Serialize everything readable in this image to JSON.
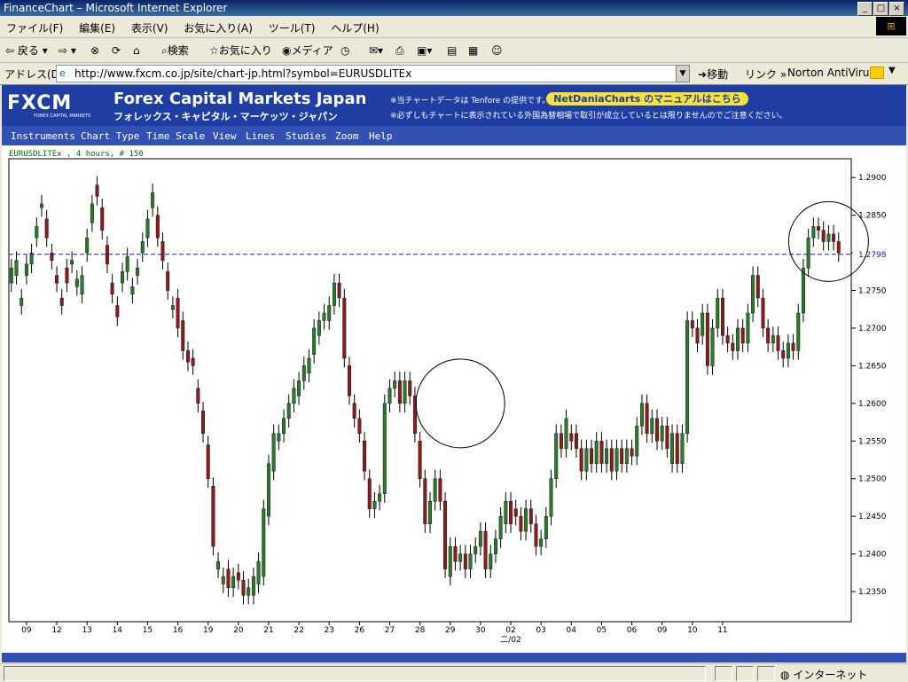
{
  "window": {
    "title": "FinanceChart – Microsoft Internet Explorer"
  },
  "menu": [
    "ファイル(F)",
    "編集(E)",
    "表示(V)",
    "お気に入り(A)",
    "ツール(T)",
    "ヘルプ(H)"
  ],
  "toolbar": {
    "back": "戻る",
    "search": "検索",
    "favorites": "お気に入り",
    "media": "メディア"
  },
  "address": {
    "label": "アドレス(D)",
    "url": "http://www.fxcm.co.jp/site/chart-jp.html?symbol=EURUSDLITEx",
    "go": "移動",
    "links": "リンク",
    "norton": "Norton AntiVirus"
  },
  "header": {
    "logo": "FXCM",
    "logo_sub": "FOREX CAPITAL MARKETS",
    "brand_en": "Forex Capital Markets Japan",
    "brand_jp": "フォレックス・キャピタル・マーケッツ・ジャパン",
    "note1": "※当チャートデータは Tenfore の提供です。",
    "note2": "※必ずしもチャートに表示されている外国為替相場で取引が成立しているとは限りませんのでご注意ください。",
    "manual": "NetDaniaCharts のマニュアルはこちら"
  },
  "chart_menu": [
    "Instruments",
    "Chart Type",
    "Time Scale",
    "View",
    "Lines",
    "Studies",
    "Zoom",
    "Help"
  ],
  "status": {
    "zone": "インターネット"
  },
  "chart_data": {
    "type": "candlestick",
    "title": "EURUSDLITEx , 4 hours, # 150",
    "ylim": [
      1.231,
      1.2925
    ],
    "yticks": [
      1.29,
      1.285,
      1.28,
      1.275,
      1.27,
      1.265,
      1.26,
      1.255,
      1.25,
      1.245,
      1.24,
      1.235
    ],
    "yticks_labels": [
      "1.2900",
      "1.2850",
      "1.2798",
      "1.2750",
      "1.2700",
      "1.2650",
      "1.2600",
      "1.2550",
      "1.2500",
      "1.2450",
      "1.2400",
      "1.2350"
    ],
    "current_level": 1.2798,
    "current_label": "1.2798",
    "x_ticks": [
      [
        "09",
        0
      ],
      [
        "12",
        1
      ],
      [
        "13",
        2
      ],
      [
        "14",
        3
      ],
      [
        "15",
        4
      ],
      [
        "16",
        5
      ],
      [
        "19",
        6
      ],
      [
        "20",
        7
      ],
      [
        "21",
        8
      ],
      [
        "22",
        9
      ],
      [
        "23",
        10
      ],
      [
        "26",
        11
      ],
      [
        "27",
        12
      ],
      [
        "28",
        13
      ],
      [
        "29",
        14
      ],
      [
        "30",
        15
      ],
      [
        "02",
        16
      ],
      [
        "03",
        17
      ],
      [
        "04",
        18
      ],
      [
        "05",
        19
      ],
      [
        "06",
        20
      ],
      [
        "09",
        21
      ],
      [
        "10",
        22
      ],
      [
        "11",
        23
      ]
    ],
    "x_month_label": "二/02",
    "x_month_day": 16,
    "candles": [
      [
        1.276,
        1.278,
        1.277,
        1.279,
        1.273,
        1.274,
        1.277,
        1.2785,
        1.2785,
        1.28,
        1.282,
        1.2835,
        1.286,
        1.2865,
        1.2845,
        1.282,
        1.28,
        1.279,
        1.277,
        1.276,
        1.274,
        1.273
      ],
      [
        1.278,
        1.276,
        1.2785,
        1.279,
        1.2755,
        1.2765,
        1.2745,
        1.277,
        1.28,
        1.282,
        1.284,
        1.2865,
        1.289,
        1.2875,
        1.286,
        1.283,
        1.281,
        1.2785,
        1.276,
        1.2745,
        1.273,
        1.2715
      ],
      [
        1.276,
        1.2775,
        1.2775,
        1.2795,
        1.2745,
        1.2755,
        1.277,
        1.278,
        1.28,
        1.2815,
        1.282,
        1.2845,
        1.286,
        1.288,
        1.285,
        1.282,
        1.2815,
        1.279,
        1.2775,
        1.275,
        1.2725,
        1.273
      ],
      [
        1.274,
        1.27,
        1.271,
        1.267,
        1.267,
        1.2655,
        1.266,
        1.265,
        1.262,
        1.26,
        1.259,
        1.256,
        1.2545,
        1.25,
        1.249,
        1.241,
        1.238,
        1.239,
        1.236,
        1.237,
        1.238,
        1.2355
      ],
      [
        1.2355,
        1.237,
        1.2375,
        1.2365,
        1.2365,
        1.2345,
        1.2345,
        1.2355,
        1.2345,
        1.237,
        1.236,
        1.239,
        1.237,
        1.246,
        1.245,
        1.252,
        1.251,
        1.256,
        1.255,
        1.256,
        1.256,
        1.258
      ],
      [
        1.258,
        1.26,
        1.26,
        1.262,
        1.261,
        1.263,
        1.263,
        1.265,
        1.264,
        1.266,
        1.2665,
        1.27,
        1.269,
        1.271,
        1.271,
        1.272,
        1.271,
        1.273,
        1.273,
        1.276,
        1.276,
        1.274
      ],
      [
        1.274,
        1.266,
        1.265,
        1.261,
        1.26,
        1.258,
        1.258,
        1.256,
        1.255,
        1.251,
        1.25,
        1.246,
        1.246,
        1.247,
        1.247,
        1.248,
        1.248,
        1.26,
        1.26,
        1.262,
        1.262,
        1.263
      ],
      [
        1.263,
        1.26,
        1.26,
        1.263,
        1.263,
        1.261,
        1.261,
        1.256,
        1.255,
        1.25,
        1.25,
        1.244,
        1.244,
        1.247,
        1.247,
        1.25,
        1.25,
        1.247,
        1.247,
        1.238,
        1.237,
        1.241
      ],
      [
        1.241,
        1.239,
        1.239,
        1.24,
        1.24,
        1.238,
        1.238,
        1.24,
        1.24,
        1.241,
        1.241,
        1.243,
        1.243,
        1.238,
        1.238,
        1.24,
        1.24,
        1.242,
        1.242,
        1.245,
        1.244,
        1.247
      ],
      [
        1.247,
        1.244,
        1.246,
        1.245,
        1.245,
        1.243,
        1.243,
        1.246,
        1.246,
        1.244,
        1.244,
        1.241,
        1.241,
        1.242,
        1.242,
        1.245,
        1.245,
        1.25,
        1.25,
        1.256,
        1.256,
        1.254
      ],
      [
        1.254,
        1.258,
        1.256,
        1.255,
        1.256,
        1.254,
        1.254,
        1.251,
        1.251,
        1.254,
        1.254,
        1.252,
        1.252,
        1.255,
        1.255,
        1.252,
        1.252,
        1.254,
        1.254,
        1.251,
        1.251,
        1.254
      ],
      [
        1.254,
        1.252,
        1.252,
        1.254,
        1.254,
        1.253,
        1.253,
        1.257,
        1.257,
        1.26,
        1.26,
        1.256,
        1.256,
        1.258,
        1.258,
        1.255,
        1.255,
        1.257,
        1.257,
        1.254,
        1.252,
        1.256
      ],
      [
        1.256,
        1.252,
        1.252,
        1.256,
        1.256,
        1.271,
        1.271,
        1.27,
        1.27,
        1.268,
        1.269,
        1.272,
        1.272,
        1.265,
        1.265,
        1.27,
        1.27,
        1.274,
        1.274,
        1.269,
        1.269,
        1.268
      ],
      [
        1.268,
        1.267,
        1.267,
        1.27,
        1.27,
        1.268,
        1.268,
        1.272,
        1.272,
        1.277,
        1.277,
        1.274,
        1.274,
        1.27,
        1.27,
        1.268,
        1.268,
        1.269,
        1.269,
        1.267,
        1.267,
        1.266
      ],
      [
        1.266,
        1.268,
        1.268,
        1.267,
        1.267,
        1.272,
        1.272,
        1.278,
        1.278,
        1.282,
        1.282,
        1.2835,
        1.2835,
        1.283,
        1.283,
        1.2815,
        1.2815,
        1.2825,
        1.2825,
        1.2815,
        1.2815,
        1.28
      ]
    ]
  }
}
